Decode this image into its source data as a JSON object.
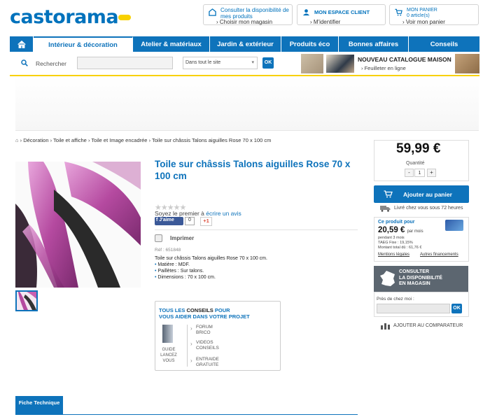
{
  "header": {
    "logo_text": "castorama",
    "boxes": [
      {
        "line1": "Consulter la disponibilité de mes produits",
        "line2": "Choisir mon magasin"
      },
      {
        "line1": "MON ESPACE CLIENT",
        "line2": "M'identifier"
      },
      {
        "line1": "MON PANIER",
        "line1b": "0 article(s)",
        "line2": "Voir mon panier"
      }
    ]
  },
  "nav": {
    "items": [
      "Intérieur & décoration",
      "Atelier & matériaux",
      "Jardin & extérieur",
      "Produits éco",
      "Bonnes affaires",
      "Conseils"
    ]
  },
  "search": {
    "label": "Rechercher",
    "scope": "Dans tout le site",
    "ok": "OK"
  },
  "catalogue": {
    "title": "NOUVEAU CATALOGUE MAISON",
    "sub": "Feuilleter en ligne"
  },
  "breadcrumb": {
    "items": [
      "Décoration",
      "Toile et affiche",
      "Toile et Image encadrée",
      "Toile sur châssis Talons aiguilles Rose 70 x 100 cm"
    ]
  },
  "product": {
    "title": "Toile sur châssis Talons aiguilles Rose 70 x 100 cm",
    "review_prefix": "Soyez le premier à",
    "review_link": "écrire un avis",
    "fb_label": "J'aime",
    "fb_count": "0",
    "gplus": "+1",
    "print": "Imprimer",
    "ref": "Réf : 651848",
    "desc_title": "Toile sur châssis Talons aiguilles Rose 70 x 100 cm.",
    "desc_items": [
      "Matière : MDF.",
      "Paillètes : Sur talons.",
      "Dimensions : 70 x 100 cm."
    ]
  },
  "conseils": {
    "h1a": "TOUS LES",
    "h1b": "CONSEILS",
    "h1c": "POUR",
    "h2": "VOUS AIDER DANS VOTRE PROJET",
    "book_label": "GUIDE LANCEZ VOUS",
    "links": [
      "FORUM BRICO",
      "VIDEOS CONSEILS",
      "ENTRAIDE GRATUITE"
    ]
  },
  "tab": {
    "label": "Fiche Technique"
  },
  "buy": {
    "price": "59,99 €",
    "qty_label": "Quantité",
    "qty": "1",
    "minus": "-",
    "plus": "+",
    "add": "Ajouter au panier",
    "delivery": "Livré chez vous sous 72 heures"
  },
  "credit": {
    "title": "Ce produit pour",
    "amount": "20,59 €",
    "per": "par mois",
    "months": "pendant 3 mois",
    "taeg": "TAEG Fixe : 19,15%",
    "total": "Montant total dû : 61,76 €",
    "legal": "Mentions légales",
    "others": "Autres financements"
  },
  "store": {
    "title1": "CONSULTER",
    "title2": "LA DISPONIBILITÉ",
    "title3": "EN MAGASIN",
    "near": "Près de chez moi :",
    "ok": "OK"
  },
  "compare": {
    "label": "AJOUTER AU COMPARATEUR"
  },
  "colors": {
    "brand_blue": "#0e73bb",
    "brand_yellow": "#f8d100",
    "product_pink": "#c95fb0"
  }
}
